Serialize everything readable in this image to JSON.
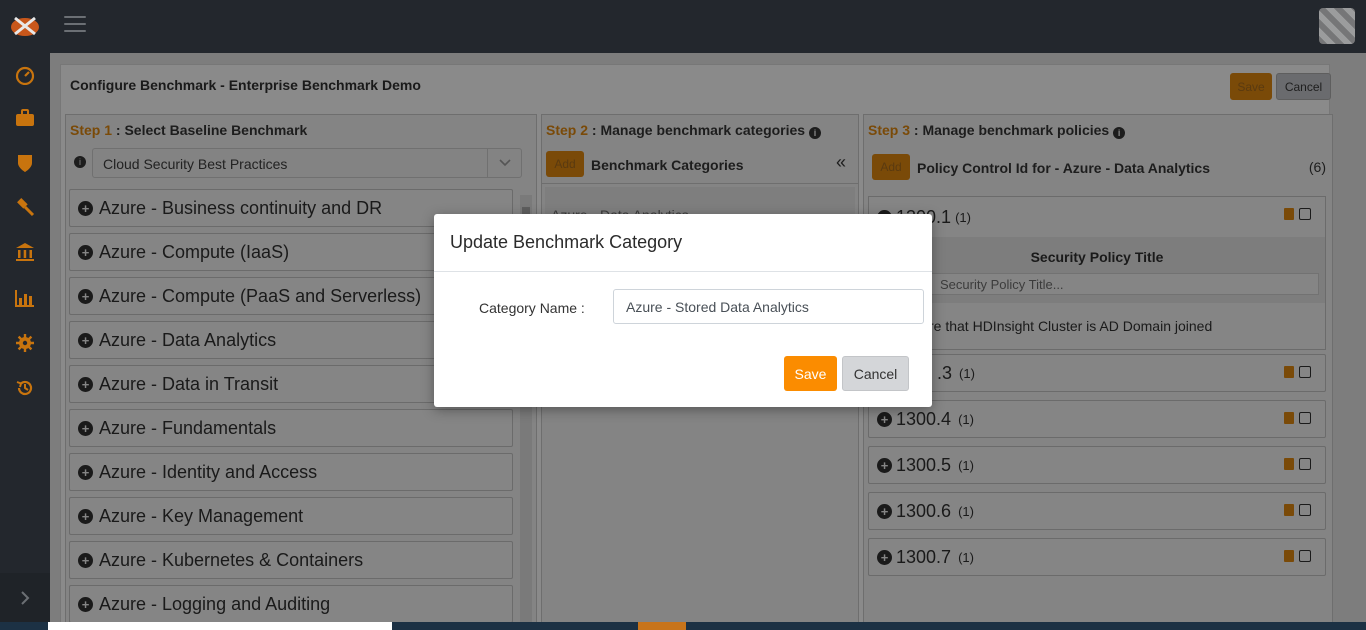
{
  "header": {
    "menu_icon": "hamburger-icon",
    "logo_icon": "app-logo-icon"
  },
  "sidebar": {
    "items": [
      {
        "icon": "dashboard-gauge-icon"
      },
      {
        "icon": "briefcase-icon"
      },
      {
        "icon": "shield-icon"
      },
      {
        "icon": "gavel-icon"
      },
      {
        "icon": "bank-icon"
      },
      {
        "icon": "bar-chart-icon"
      },
      {
        "icon": "gear-icon"
      },
      {
        "icon": "history-icon"
      }
    ],
    "expand_icon": "chevron-right-icon"
  },
  "page": {
    "title": "Configure Benchmark - Enterprise Benchmark Demo",
    "save_label": "Save",
    "cancel_label": "Cancel"
  },
  "step1": {
    "step": "Step 1",
    "title": " : Select Baseline Benchmark",
    "select_value": "Cloud Security Best Practices",
    "items": [
      "Azure - Business continuity and DR",
      "Azure - Compute (IaaS)",
      "Azure - Compute (PaaS and Serverless)",
      "Azure - Data Analytics",
      "Azure - Data in Transit",
      "Azure - Fundamentals",
      "Azure - Identity and Access",
      "Azure - Key Management",
      "Azure - Kubernetes & Containers",
      "Azure - Logging and Auditing"
    ]
  },
  "step2": {
    "step": "Step 2",
    "title": " : Manage benchmark categories",
    "add_label": "Add",
    "list_title": "Benchmark Categories",
    "collapse": "«",
    "items": [
      "Azure - Data Analytics"
    ]
  },
  "step3": {
    "step": "Step 3",
    "title": " : Manage benchmark policies",
    "add_label": "Add",
    "list_title": "Policy Control Id for - Azure - Data Analytics",
    "count": "(6)",
    "expanded": {
      "id": "1300.1",
      "count": "(1)",
      "table_header": "Security Policy Title",
      "filter_placeholder": "Security Policy Title...",
      "row": "re that HDInsight Cluster is AD Domain joined"
    },
    "items": [
      {
        "id": ".3",
        "count": "(1)"
      },
      {
        "id": "1300.4",
        "count": "(1)"
      },
      {
        "id": "1300.5",
        "count": "(1)"
      },
      {
        "id": "1300.6",
        "count": "(1)"
      },
      {
        "id": "1300.7",
        "count": "(1)"
      }
    ]
  },
  "modal": {
    "title": "Update Benchmark Category",
    "label": "Category Name :",
    "value": "Azure - Stored Data Analytics",
    "save_label": "Save",
    "cancel_label": "Cancel"
  }
}
